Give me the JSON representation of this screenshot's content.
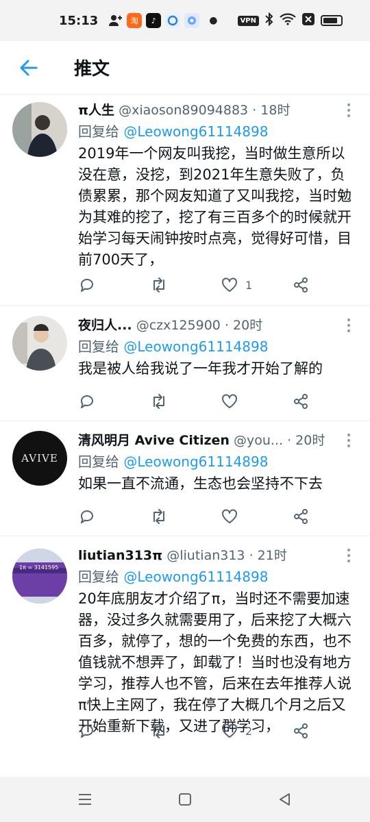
{
  "status_bar": {
    "time": "15:13",
    "icons": [
      "person-add-icon",
      "taobao-icon",
      "tiktok-icon",
      "browser-icon",
      "assistant-icon"
    ],
    "vpn_label": "VPN",
    "battery_level": 0.85
  },
  "header": {
    "back_icon": "arrow-left-icon",
    "title": "推文"
  },
  "tweets": [
    {
      "name": "π人生",
      "handle": "@xiaoson89094883",
      "time": "· 18时",
      "reply_prefix": "回复给",
      "reply_to": "@Leowong61114898",
      "text": "2019年一个网友叫我挖，当时做生意所以没在意，没挖，到2021年生意失败了，负债累累，那个网友知道了又叫我挖，当时勉为其难的挖了，挖了有三百多个的时候就开始学习每天闹钟按时点亮，觉得好可惜，目前700天了，",
      "like_count": "1"
    },
    {
      "name": "夜归人...",
      "handle": "@czx125900",
      "time": "· 20时",
      "reply_prefix": "回复给",
      "reply_to": "@Leowong61114898",
      "text": "我是被人给我说了一年我才开始了解的",
      "like_count": ""
    },
    {
      "name": "清风明月 Avive Citizen",
      "handle": "@you...",
      "time": "· 20时",
      "reply_prefix": "回复给",
      "reply_to": "@Leowong61114898",
      "avatar_text": "AVIVE",
      "text": "如果一直不流通，生态也会坚持不下去",
      "like_count": ""
    },
    {
      "name": "liutian313π",
      "handle": "@liutian313",
      "time": "· 21时",
      "reply_prefix": "回复给",
      "reply_to": "@Leowong61114898",
      "avatar_text": "1π = 3141595",
      "text": "20年底朋友才介绍了π，当时还不需要加速器，没过多久就需要用了，后来挖了大概六百多，就停了，想的一个免费的东西，也不值钱就不想弄了，卸载了！当时也没有地方学习，推荐人也不管，后来在去年推荐人说π快上主网了，我在停了大概几个月之后又开始重新下载，又进了群学习，",
      "like_count": "2"
    }
  ],
  "colors": {
    "accent": "#1d9bf0",
    "text": "#0f1419",
    "secondary": "#536471",
    "divider": "#e6ecf0"
  }
}
